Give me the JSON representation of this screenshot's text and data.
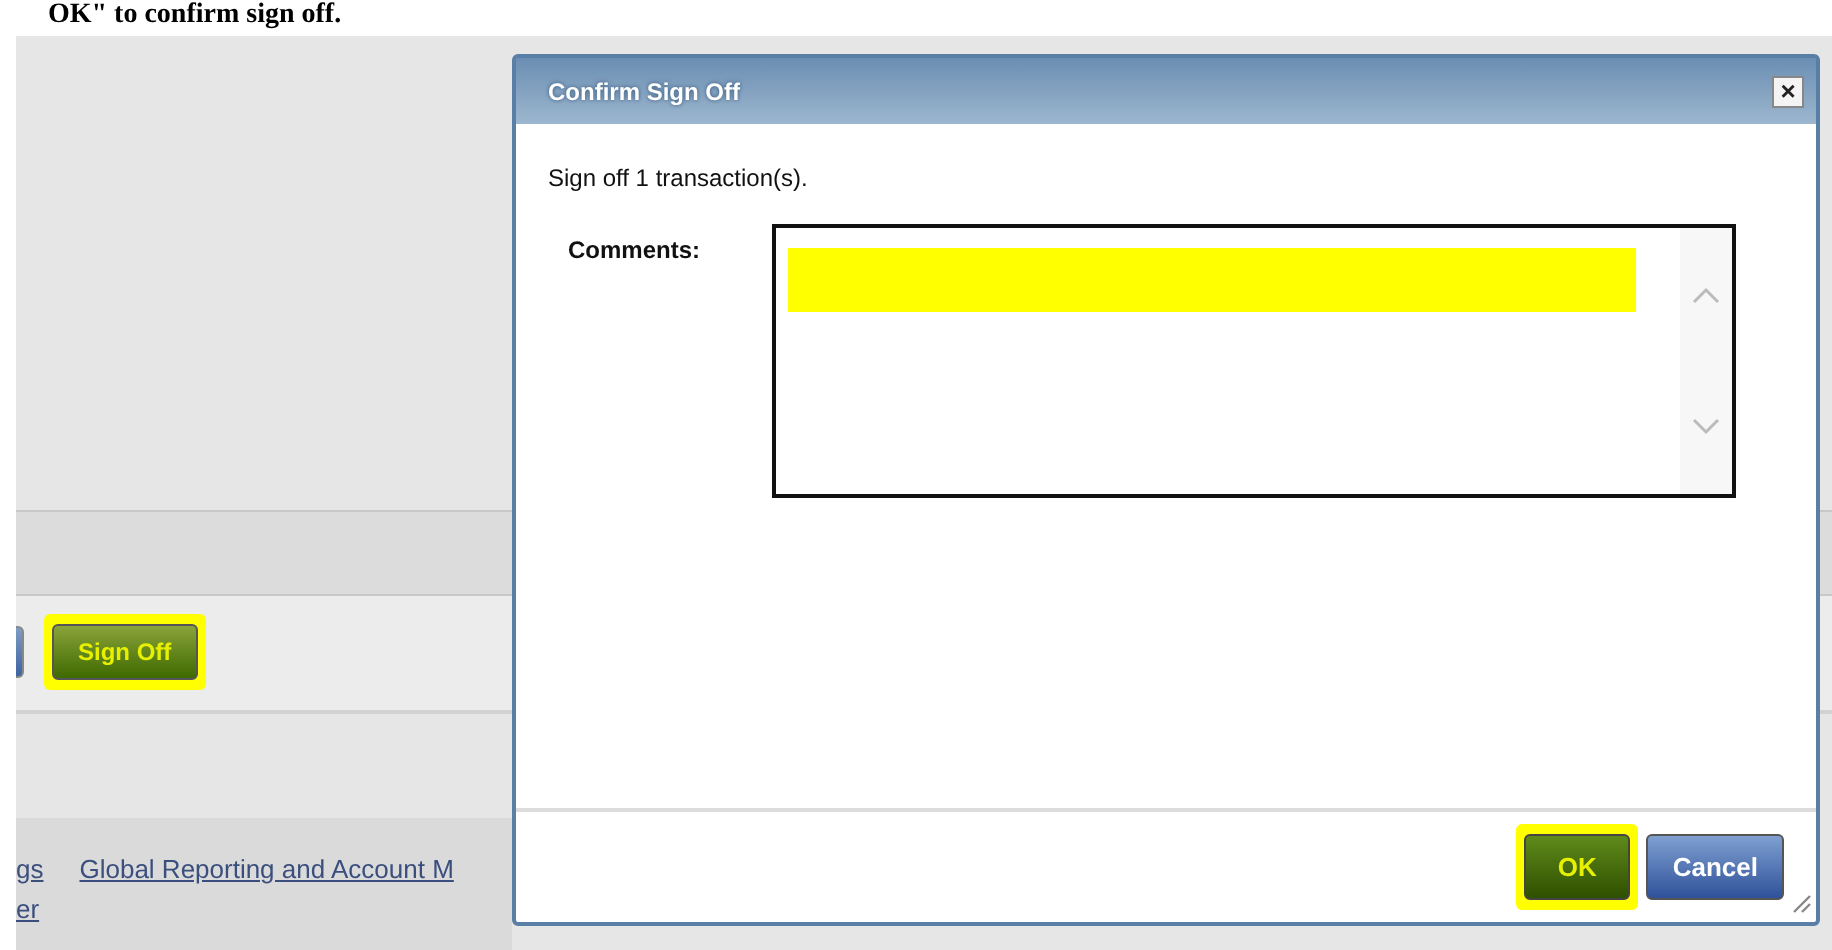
{
  "caption": "OK\" to confirm sign off.",
  "app": {
    "toolbar_buttons": [
      {
        "kind": "cut"
      },
      {
        "kind": "sign",
        "label": "Sign Off",
        "highlighted": true
      }
    ],
    "footer_links": [
      {
        "lines": [
          "gs",
          "er"
        ]
      },
      {
        "lines": [
          "Global Reporting and Account M"
        ]
      }
    ]
  },
  "dialog": {
    "title": "Confirm Sign Off",
    "close": "×",
    "message": "Sign off 1 transaction(s).",
    "comments": {
      "label": "Comments:",
      "redacted": true
    },
    "buttons": [
      {
        "kind": "ok",
        "label": "OK",
        "highlighted": true
      },
      {
        "kind": "cancel",
        "label": "Cancel",
        "highlighted": false
      }
    ]
  }
}
